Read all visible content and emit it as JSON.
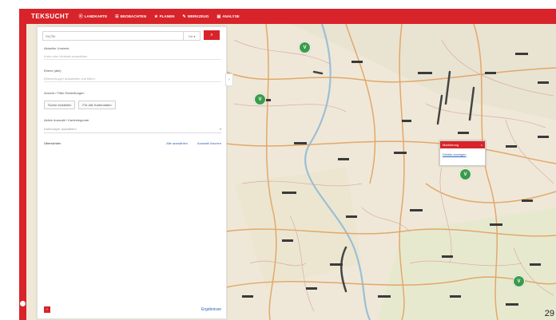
{
  "app": {
    "brand": "TEKSUCHT",
    "accent": "#d8232a"
  },
  "nav": {
    "items": [
      {
        "icon": "location-icon",
        "label": "LANDKARTE"
      },
      {
        "icon": "list-icon",
        "label": "BEOBACHTEN"
      },
      {
        "icon": "star-icon",
        "label": "PLANEN"
      },
      {
        "icon": "wrench-icon",
        "label": "WERKZEUG"
      },
      {
        "icon": "chart-icon",
        "label": "ANALYSE"
      }
    ]
  },
  "panel": {
    "search": {
      "placeholder": "Suche",
      "select": "Ort",
      "button_icon": "search-icon"
    },
    "field1": {
      "label": "Aktueller Umkreis",
      "value": "Kreis oder Umkreis auswählen"
    },
    "field2": {
      "label": "Ebene (alle)",
      "value": "Ebenen/Layer auswählen und filtern"
    },
    "chips_label": "Ansicht / Filter Einstellungen",
    "chips": [
      "Suche einstellen",
      "Für alle Kartendaten"
    ],
    "select_label": "Aktive Auswahl / Kartenlegende",
    "select_value": "Kartenlayer auswählen",
    "row": {
      "left": "Übersichten",
      "right1": "Alle auswählen",
      "right2": "Auswahl löschen"
    },
    "bottom_link": "Ergebnisse"
  },
  "popup": {
    "title": "Markierung",
    "link": "Details anzeigen"
  },
  "corner_label": "29"
}
